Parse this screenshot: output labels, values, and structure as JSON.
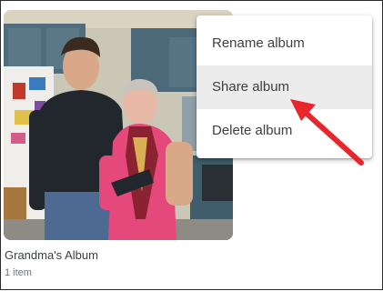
{
  "album": {
    "title": "Grandma's Album",
    "count": "1 item"
  },
  "menu": {
    "items": [
      {
        "label": "Rename album"
      },
      {
        "label": "Share album",
        "highlighted": true
      },
      {
        "label": "Delete album"
      }
    ]
  },
  "colors": {
    "highlight_arrow": "#e8262b",
    "menu_hover": "#ececec"
  }
}
